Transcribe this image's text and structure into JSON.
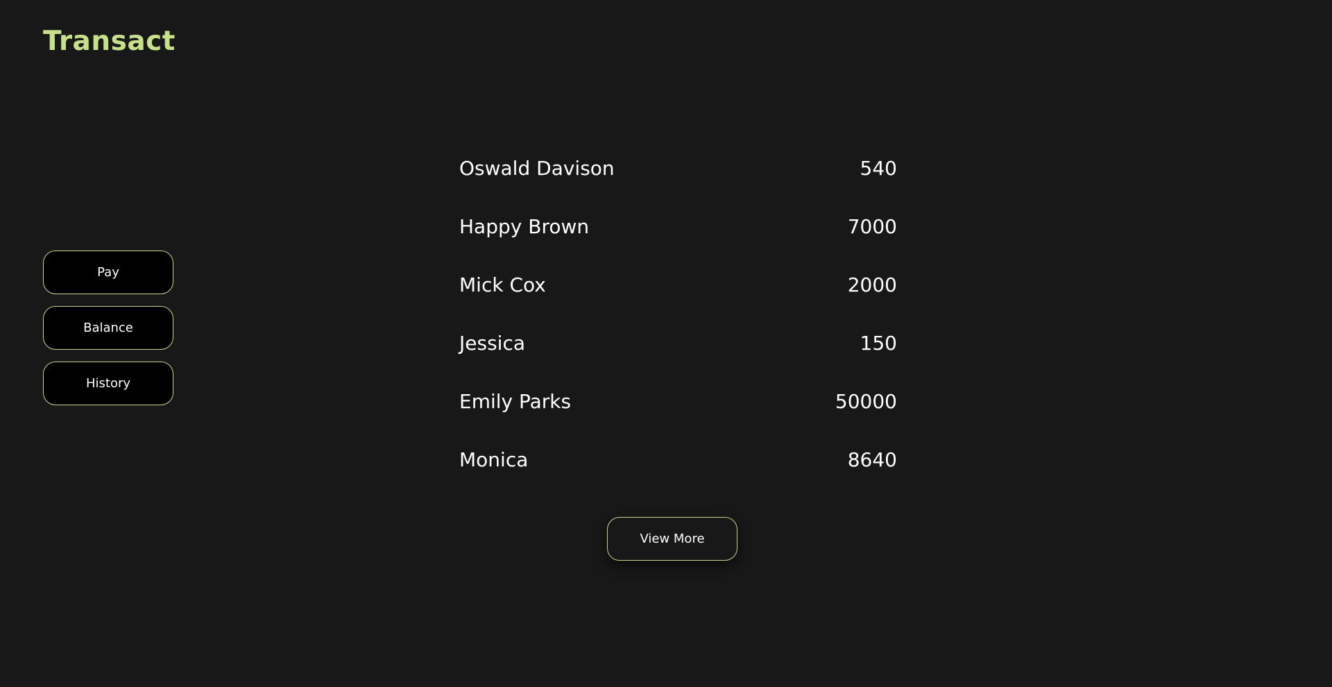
{
  "brand": {
    "title": "Transact",
    "color": "#c7e08c"
  },
  "theme": {
    "background": "#181818",
    "button_background": "#000000",
    "button_border": "#c7d68f",
    "text": "#ffffff"
  },
  "nav": {
    "items": [
      {
        "label": "Pay"
      },
      {
        "label": "Balance"
      },
      {
        "label": "History"
      }
    ]
  },
  "transactions": [
    {
      "name": "Oswald Davison",
      "amount": "540"
    },
    {
      "name": "Happy Brown",
      "amount": "7000"
    },
    {
      "name": "Mick Cox",
      "amount": "2000"
    },
    {
      "name": "Jessica",
      "amount": "150"
    },
    {
      "name": "Emily Parks",
      "amount": "50000"
    },
    {
      "name": "Monica",
      "amount": "8640"
    }
  ],
  "view_more": {
    "label": "View More"
  }
}
